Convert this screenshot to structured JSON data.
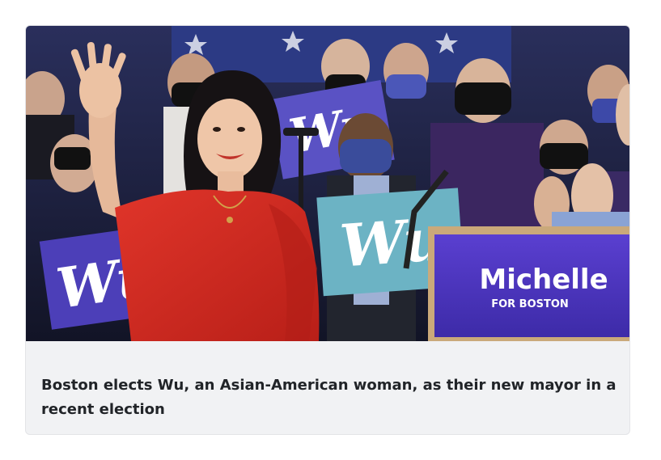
{
  "article": {
    "image": {
      "sign_text": "Wu",
      "podium_name": "Michelle",
      "podium_subtitle": "FOR BOSTON"
    },
    "caption": "Boston elects Wu, an Asian-American woman, as their new mayor in a recent election"
  },
  "colors": {
    "caption_bg": "#f1f2f4",
    "caption_text": "#212428",
    "dress_red": "#d5281f",
    "sign_blue": "#4c3fb8",
    "sign_teal": "#5fa7b7"
  }
}
